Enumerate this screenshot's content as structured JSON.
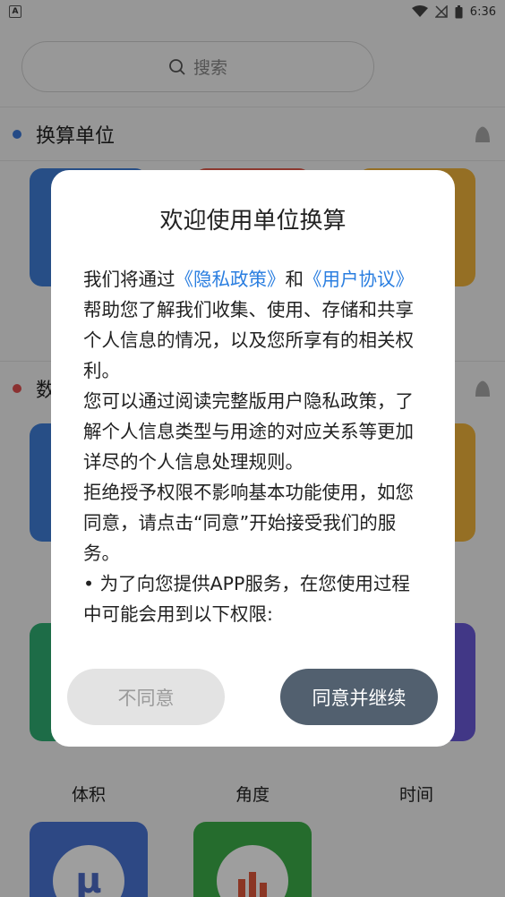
{
  "status_bar": {
    "left_icon": "A",
    "time": "6:36"
  },
  "search": {
    "placeholder": "搜索"
  },
  "sections": [
    {
      "title": "换算单位",
      "dot_color": "#3a78d8"
    },
    {
      "title": "数",
      "dot_color": "#e05050"
    }
  ],
  "tiles": {
    "row1_colors": [
      "#3f7fd9",
      "#e25b4c",
      "#f0b43a"
    ],
    "row2_colors": [
      "#3f7fd9",
      "#e25b4c",
      "#f0b43a"
    ],
    "row3_colors": [
      "#2fae73",
      "#4a7ff0",
      "#6a5ad8"
    ],
    "row3_labels": [
      "体积",
      "角度",
      "时间"
    ],
    "row4_colors": [
      "#4a74d6",
      "#3daf4a"
    ],
    "row4_icon_glyph": "μ"
  },
  "dialog": {
    "title": "欢迎使用单位换算",
    "p1_a": "我们将通过",
    "p1_link1": "《隐私政策》",
    "p1_b": "和",
    "p1_link2": "《用户协议》",
    "p1_c": "帮助您了解我们收集、使用、存储和共享个人信息的情况，以及您所享有的相关权利。",
    "p2": "您可以通过阅读完整版用户隐私政策，了解个人信息类型与用途的对应关系等更加详尽的个人信息处理规则。",
    "p3": "拒绝授予权限不影响基本功能使用，如您同意，请点击“同意”开始接受我们的服务。",
    "p4": "• 为了向您提供APP服务，在您使用过程中可能会用到以下权限:",
    "disagree_label": "不同意",
    "agree_label": "同意并继续"
  }
}
